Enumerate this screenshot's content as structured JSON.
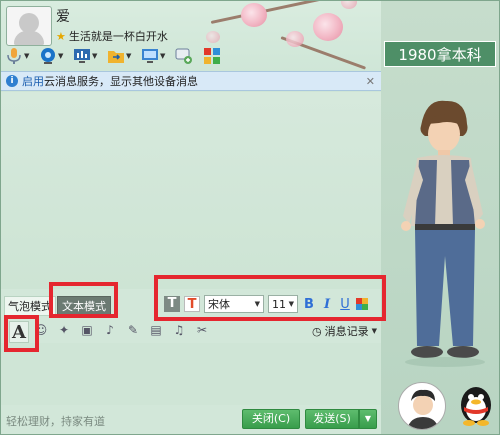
{
  "contact": {
    "name": "爱",
    "signature": "生活就是一杯白开水"
  },
  "window_controls": {
    "minimize": "—",
    "maximize": "□",
    "close": "✕"
  },
  "toolbar_top": {
    "items": [
      {
        "name": "mic-icon",
        "color": "#f0a53a"
      },
      {
        "name": "video-icon",
        "color": "#1a73c8"
      },
      {
        "name": "share-screen-icon",
        "color": "#2e6ab0"
      },
      {
        "name": "file-transfer-icon",
        "color": "#f0b32e"
      },
      {
        "name": "remote-desktop-icon",
        "color": "#3a84d0"
      },
      {
        "name": "chat-add-icon",
        "color": "#5aa85a"
      },
      {
        "name": "apps-icon",
        "color": "#e2382a"
      }
    ]
  },
  "notice": {
    "link_text": "启用",
    "message": "云消息服务，显示其他设备消息",
    "close": "✕"
  },
  "format_bar": {
    "mode_bubble": "气泡模式",
    "mode_text": "文本模式",
    "font_name": "宋体",
    "font_size": "11",
    "bold": "B",
    "italic": "I",
    "underline": "U"
  },
  "input_toolbar": {
    "font_button": "A",
    "history_label": "消息记录"
  },
  "footer": {
    "text": "轻松理财，持家有道",
    "close_label": "关闭(C)",
    "send_label": "发送(S)"
  },
  "side": {
    "brand": "1980拿本科"
  },
  "colors": {
    "highlight": "#e5262f",
    "accent_green": "#389d4b"
  }
}
